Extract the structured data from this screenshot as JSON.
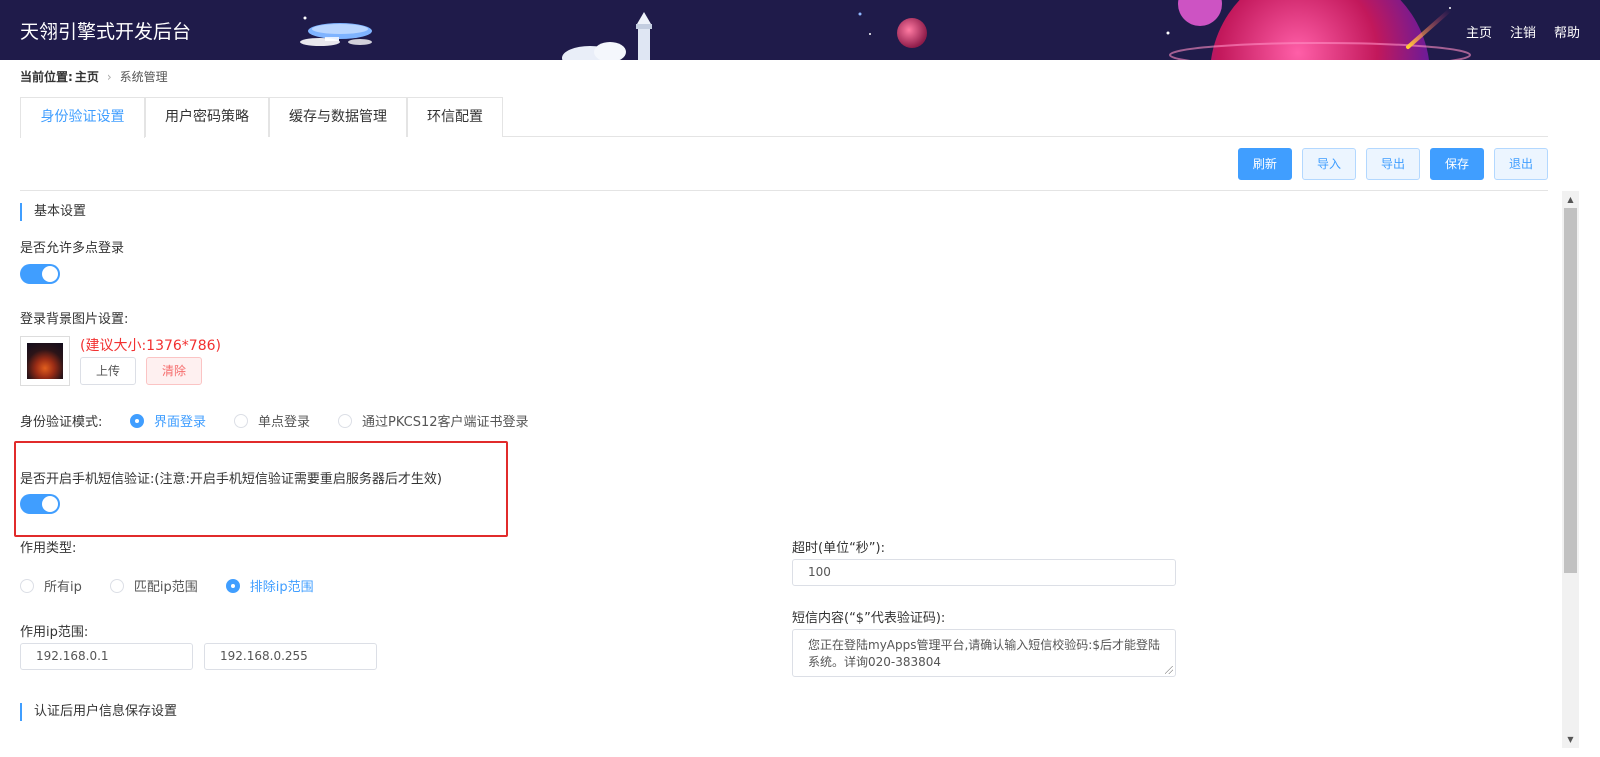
{
  "header": {
    "app_title": "天翎引擎式开发后台",
    "nav": [
      "主页",
      "注销",
      "帮助"
    ]
  },
  "breadcrumb": {
    "prefix": "当前位置:",
    "home": "主页",
    "current": "系统管理"
  },
  "tabs": [
    {
      "label": "身份验证设置",
      "active": true
    },
    {
      "label": "用户密码策略",
      "active": false
    },
    {
      "label": "缓存与数据管理",
      "active": false
    },
    {
      "label": "环信配置",
      "active": false
    }
  ],
  "toolbar": {
    "refresh": "刷新",
    "import": "导入",
    "export": "导出",
    "save": "保存",
    "exit": "退出"
  },
  "basic_settings": {
    "title": "基本设置",
    "multi_login_label": "是否允许多点登录",
    "multi_login_on": true,
    "bg_image_label": "登录背景图片设置:",
    "bg_image_hint": "(建议大小:1376*786)",
    "upload_label": "上传",
    "clear_label": "清除",
    "auth_mode_label": "身份验证模式:",
    "auth_modes": [
      {
        "label": "界面登录",
        "checked": true
      },
      {
        "label": "单点登录",
        "checked": false
      },
      {
        "label": "通过PKCS12客户端证书登录",
        "checked": false
      }
    ],
    "sms_label": "是否开启手机短信验证:(注意:开启手机短信验证需要重启服务器后才生效)",
    "sms_on": true,
    "scope_type_label": "作用类型:",
    "scope_types": [
      {
        "label": "所有ip",
        "checked": false
      },
      {
        "label": "匹配ip范围",
        "checked": false
      },
      {
        "label": "排除ip范围",
        "checked": true
      }
    ],
    "ip_range_label": "作用ip范围:",
    "ip_start": "192.168.0.1",
    "ip_end": "192.168.0.255",
    "timeout_label": "超时(单位“秒”):",
    "timeout_value": "100",
    "sms_content_label": "短信内容(“$”代表验证码):",
    "sms_content": "您正在登陆myApps管理平台,请确认输入短信校验码:$后才能登陆系统。详询020-383804"
  },
  "user_info_section": {
    "title": "认证后用户信息保存设置"
  },
  "colors": {
    "header_bg": "#1f1b4a",
    "accent": "#409eff",
    "danger": "#f23030",
    "highlight_border": "#e12b2b"
  }
}
